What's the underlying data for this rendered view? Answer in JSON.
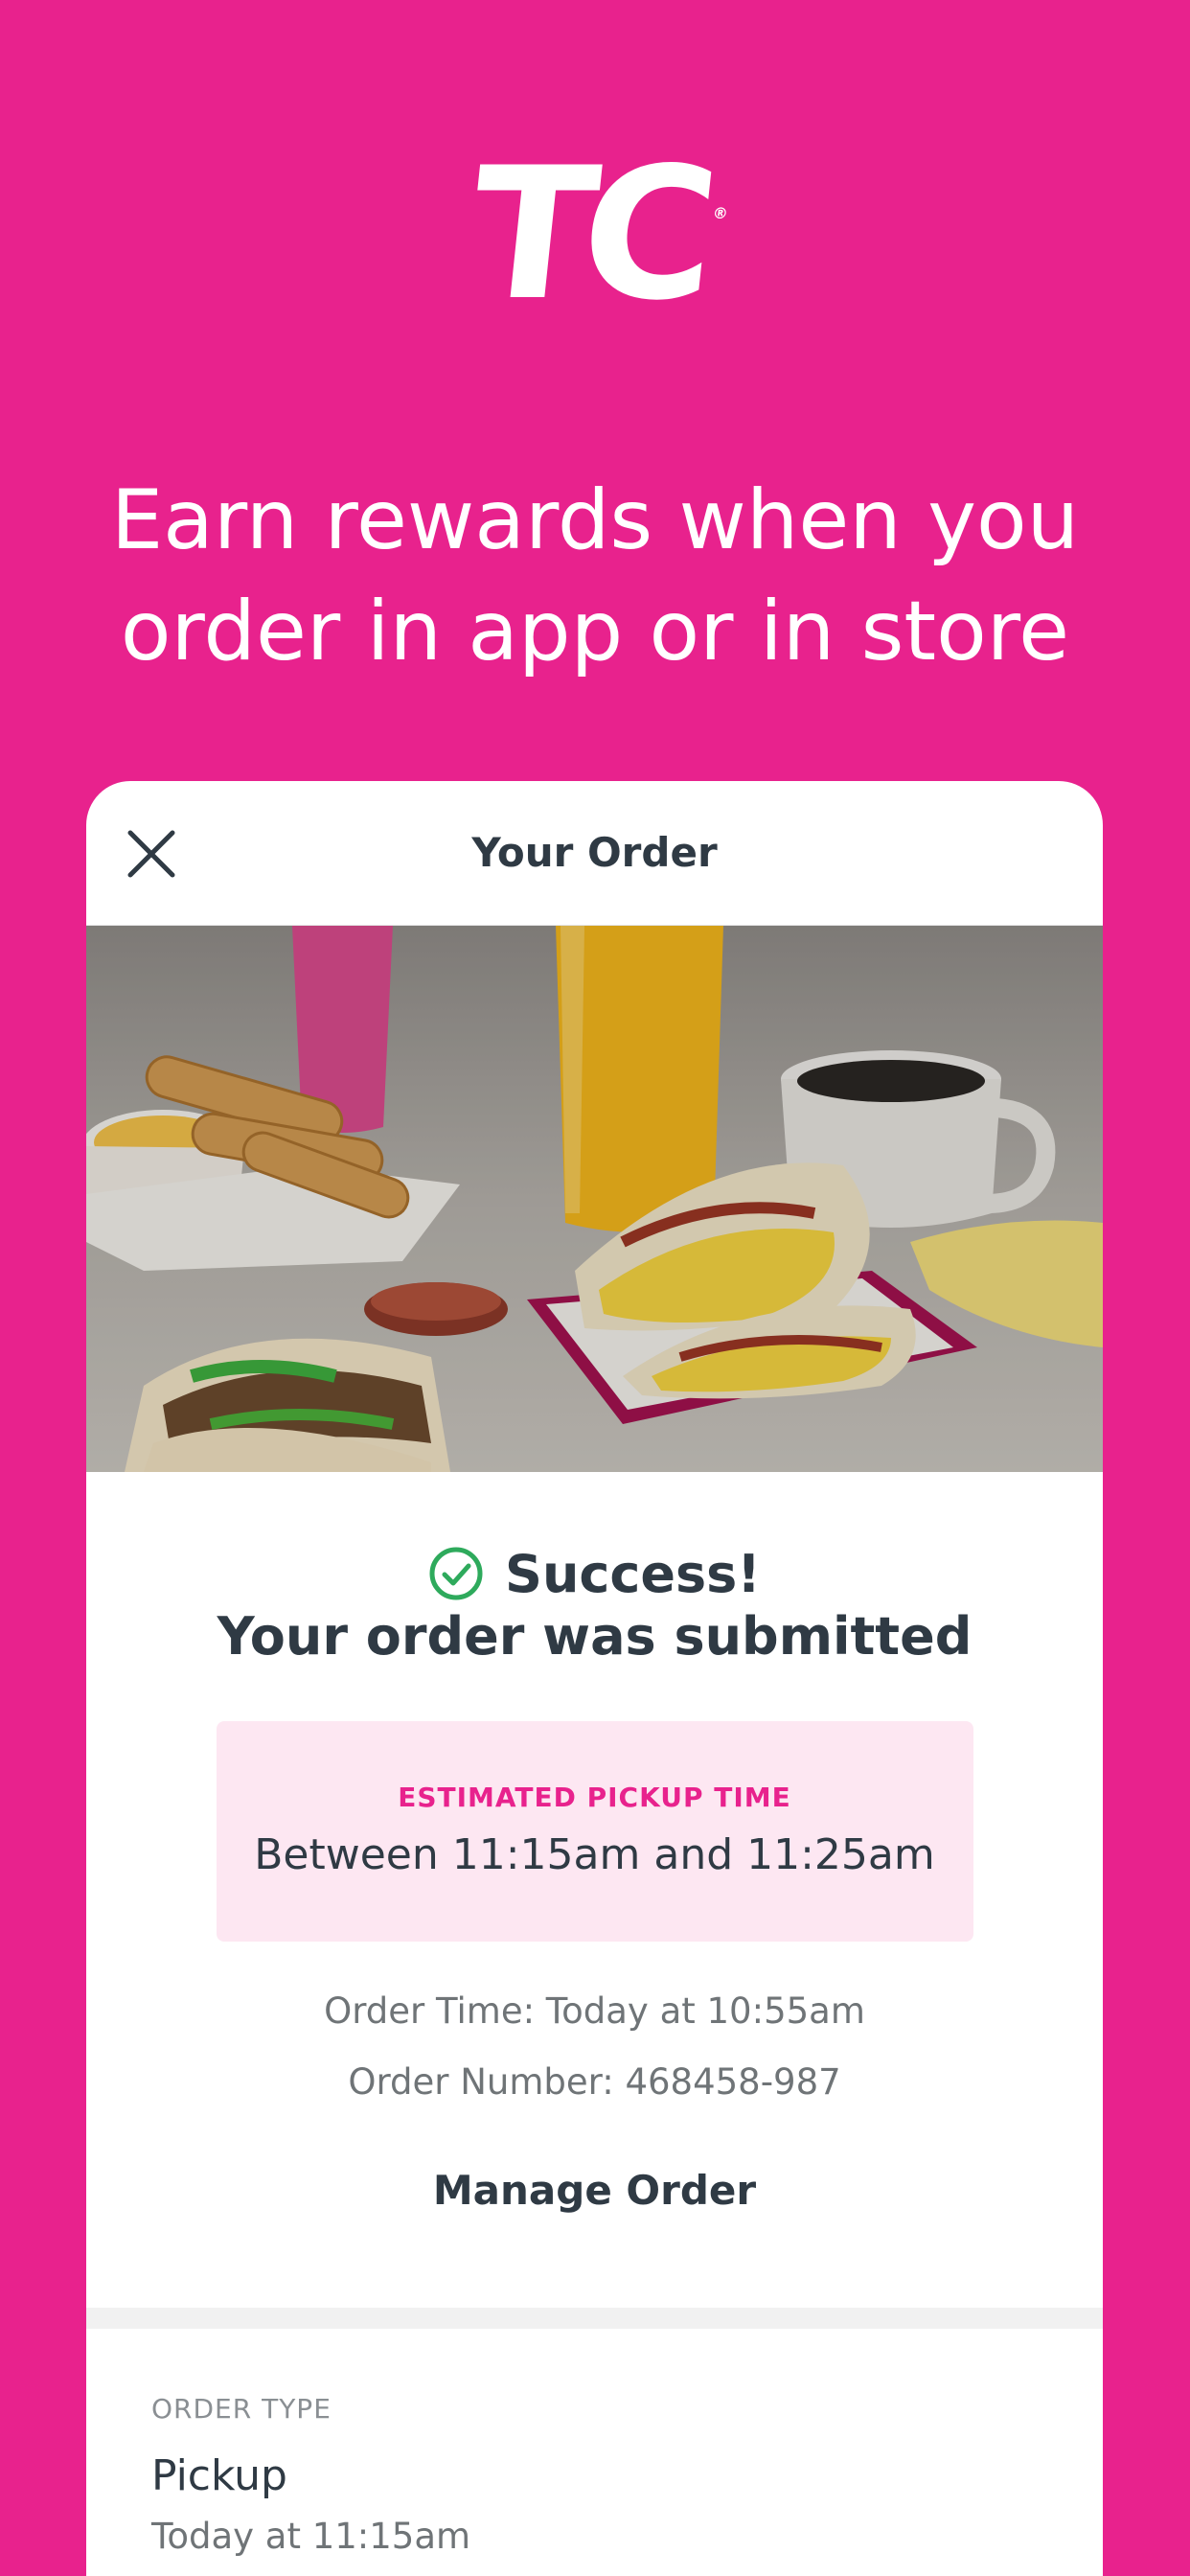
{
  "brand": {
    "logo_text": "TC",
    "logo_mark": "®"
  },
  "headline": {
    "line1": "Earn rewards when you",
    "line2": "order in app or in store"
  },
  "card": {
    "title": "Your Order",
    "close_icon": "close-icon",
    "hero_alt": "Breakfast tacos, drinks, and taquitos"
  },
  "status": {
    "icon": "check-circle-icon",
    "title": "Success!",
    "subtitle": "Your order was submitted"
  },
  "pickup": {
    "label": "ESTIMATED PICKUP TIME",
    "time": "Between 11:15am and 11:25am"
  },
  "order_info": {
    "order_time": "Order Time: Today at 10:55am",
    "order_number": "Order Number: 468458-987"
  },
  "actions": {
    "manage_label": "Manage Order"
  },
  "order_type": {
    "label": "ORDER TYPE",
    "value": "Pickup",
    "time": "Today at 11:15am"
  },
  "colors": {
    "brand_pink": "#e8228d",
    "pickup_bg": "#fde7f2",
    "success_green": "#2eaa5c",
    "text_dark": "#2f3a44"
  }
}
